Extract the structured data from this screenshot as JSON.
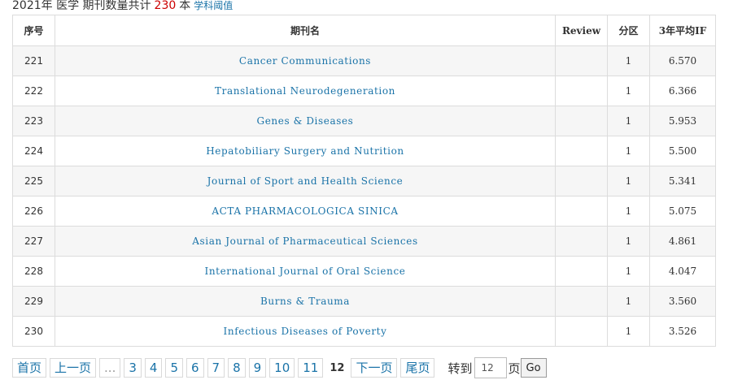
{
  "header": {
    "prefix": "2021年 医学 期刊数量共计",
    "count": "230",
    "unit": "本",
    "link": "学科阈值"
  },
  "table": {
    "columns": [
      "序号",
      "期刊名",
      "Review",
      "分区",
      "3年平均IF"
    ],
    "rows": [
      {
        "seq": "221",
        "name": "Cancer Communications",
        "review": "",
        "zone": "1",
        "if": "6.570"
      },
      {
        "seq": "222",
        "name": "Translational Neurodegeneration",
        "review": "",
        "zone": "1",
        "if": "6.366"
      },
      {
        "seq": "223",
        "name": "Genes & Diseases",
        "review": "",
        "zone": "1",
        "if": "5.953"
      },
      {
        "seq": "224",
        "name": "Hepatobiliary Surgery and Nutrition",
        "review": "",
        "zone": "1",
        "if": "5.500"
      },
      {
        "seq": "225",
        "name": "Journal of Sport and Health Science",
        "review": "",
        "zone": "1",
        "if": "5.341"
      },
      {
        "seq": "226",
        "name": "ACTA PHARMACOLOGICA SINICA",
        "review": "",
        "zone": "1",
        "if": "5.075"
      },
      {
        "seq": "227",
        "name": "Asian Journal of Pharmaceutical Sciences",
        "review": "",
        "zone": "1",
        "if": "4.861"
      },
      {
        "seq": "228",
        "name": "International Journal of Oral Science",
        "review": "",
        "zone": "1",
        "if": "4.047"
      },
      {
        "seq": "229",
        "name": "Burns & Trauma",
        "review": "",
        "zone": "1",
        "if": "3.560"
      },
      {
        "seq": "230",
        "name": "Infectious Diseases of Poverty",
        "review": "",
        "zone": "1",
        "if": "3.526"
      }
    ]
  },
  "pager": {
    "first": "首页",
    "prev": "上一页",
    "ellipsis": "...",
    "pages": [
      "3",
      "4",
      "5",
      "6",
      "7",
      "8",
      "9",
      "10",
      "11"
    ],
    "current": "12",
    "next": "下一页",
    "last": "尾页",
    "goto_label": "转到",
    "goto_value": "12",
    "page_label": "页",
    "go_button": "Go"
  }
}
